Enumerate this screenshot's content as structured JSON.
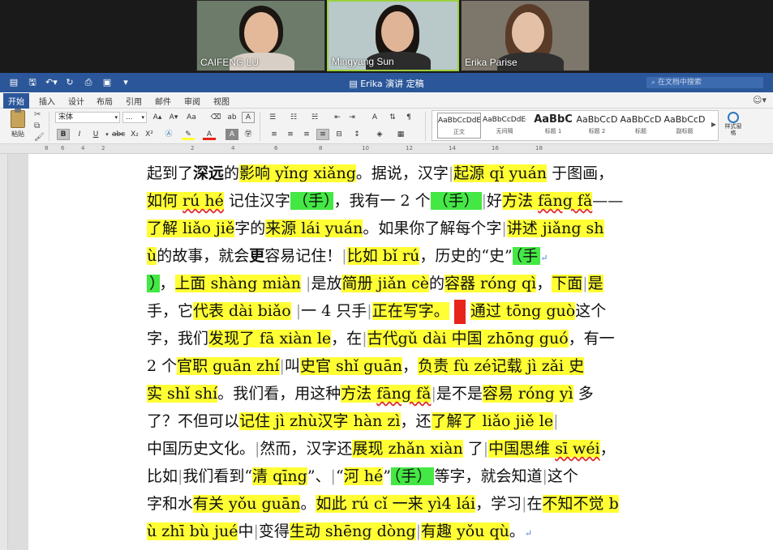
{
  "meeting": {
    "participants": [
      {
        "name": "CAIFENG LU",
        "active": false
      },
      {
        "name": "Mingyang Sun",
        "active": true
      },
      {
        "name": "Erika Parise",
        "active": false
      }
    ]
  },
  "word": {
    "title": "Erika 演讲 定稿",
    "search_placeholder": "在文档中搜索",
    "tabs": [
      "开始",
      "插入",
      "设计",
      "布局",
      "引用",
      "邮件",
      "审阅",
      "视图"
    ],
    "active_tab": "开始",
    "paste_label": "粘贴",
    "font_name": "宋体",
    "font_size": "...",
    "styles": [
      {
        "sample": "AaBbCcDdEe",
        "name": "正文"
      },
      {
        "sample": "AaBbCcDdEe",
        "name": "无间隔"
      },
      {
        "sample": "AaBbC",
        "name": "标题 1"
      },
      {
        "sample": "AaBbCcD",
        "name": "标题 2"
      },
      {
        "sample": "AaBbCcD",
        "name": "标题"
      },
      {
        "sample": "AaBbCcD",
        "name": "副标题"
      }
    ],
    "style_pane_label": "样式窗格",
    "ruler_ticks": [
      "8",
      "6",
      "4",
      "2",
      "2",
      "4",
      "6",
      "8",
      "10",
      "12",
      "14",
      "16",
      "18"
    ]
  },
  "document": {
    "lines": [
      "起到了深远的影响 yǐng xiǎng。据说，汉字|起源 qǐ yuán 于图画，",
      "如何 rú hé 记住汉字（手），我有一 2 个（手）|好方法 fāng fǎ——",
      "了解 liǎo jiě字的来源 lái yuán。如果你了解每个字|讲述 jiǎng sh",
      "ù的故事，就会更容易记住！|比如 bǐ rú，历史的“史”（手",
      "），上面 shàng miàn |是放简册 jiǎn cè的容器 róng qì，下面|是",
      "手，它代表 dài biǎo |一 4 只手|正在写字。 通过 tōng guò这个",
      "字，我们发现了 fā xiàn le，在|古代gǔ dài 中国 zhōng guó，有一",
      "2 个官职 guān zhí|叫史官  shǐ guān，负责 fù zé记载 jì zǎi 史",
      "实 shǐ shí。我们看，用这种方法 fāng fǎ|是不是容易 róng yì 多",
      "了？不但可以记住 jì zhù汉字  hàn zì，还了解了 liǎo jiě le|",
      "中国历史文化。|然而，汉字还展现 zhǎn xiàn 了|中国思维 sī wéi，",
      "比如|我们看到“清 qīng”、|“河 hé”（手）等字，就会知道|这个",
      "字和水有关 yǒu guān。如此 rú cǐ 一来 yì4 lái，学习|在不知不觉 b",
      "ù zhī bù jué中|变得生动 shēng dòng|有趣 yǒu qù。"
    ]
  }
}
